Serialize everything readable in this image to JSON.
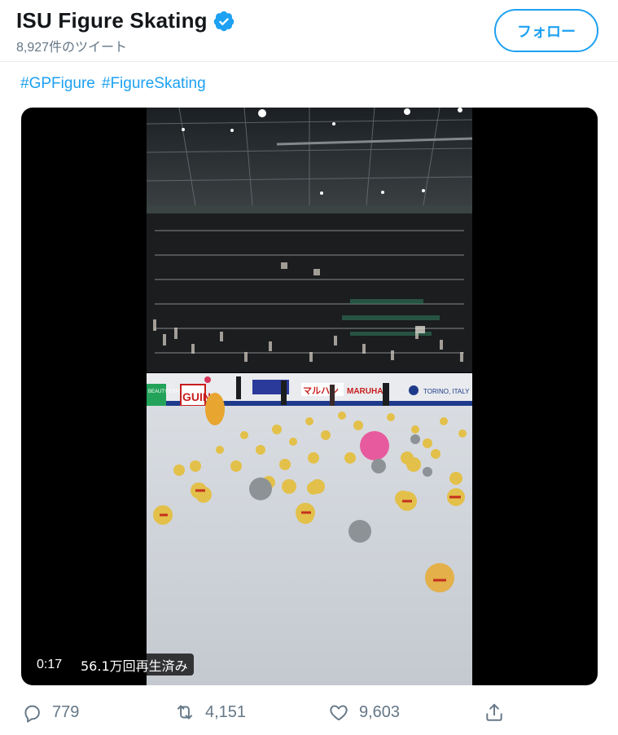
{
  "header": {
    "display_name": "ISU Figure Skating",
    "tweet_count": "8,927件のツイート",
    "follow_label": "フォロー"
  },
  "tweet": {
    "hashtags": [
      "#GPFigure",
      "#FigureSkating"
    ]
  },
  "video": {
    "timecode": "0:17",
    "views": "56.1万回再生済み",
    "board_ads": [
      "BEAUTY EXPERT",
      "GUIN",
      "マルハン",
      "MARUHAN",
      "TORINO, ITALY"
    ]
  },
  "actions": {
    "replies": "779",
    "retweets": "4,151",
    "likes": "9,603"
  },
  "colors": {
    "accent": "#1da1f2",
    "secondary_text": "#657786"
  }
}
